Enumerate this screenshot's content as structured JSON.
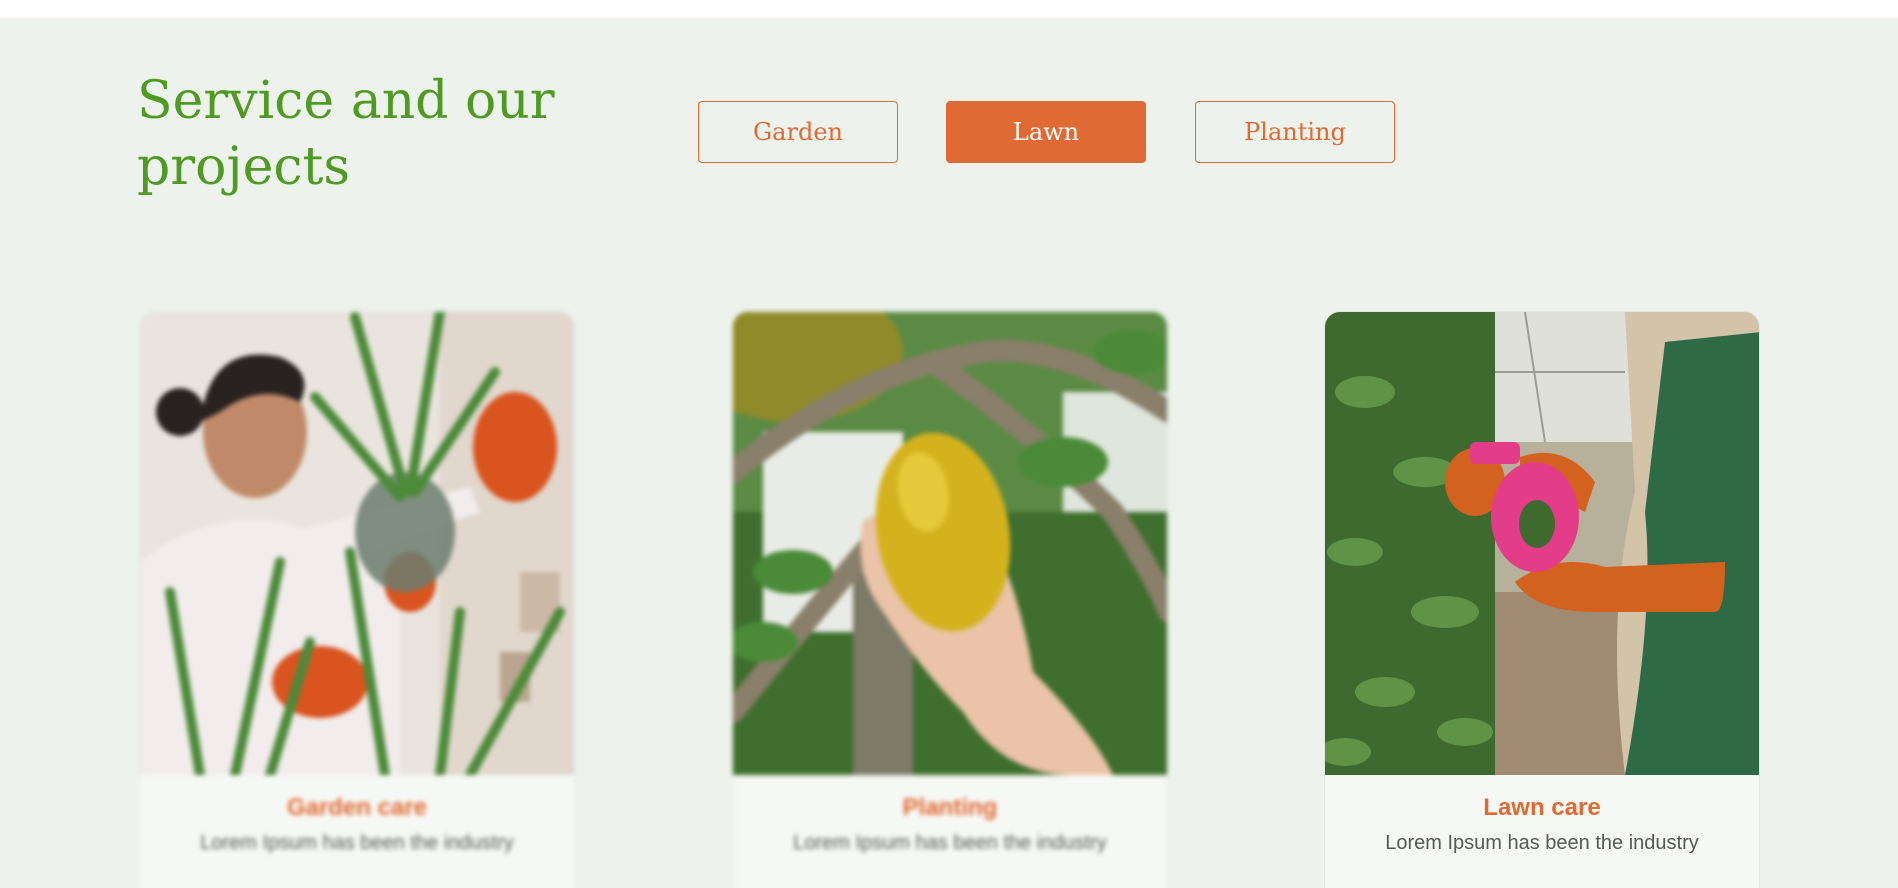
{
  "section": {
    "title": "Service and our projects"
  },
  "tabs": [
    {
      "label": "Garden",
      "active": false
    },
    {
      "label": "Lawn",
      "active": true
    },
    {
      "label": "Planting",
      "active": false
    }
  ],
  "cards": [
    {
      "title": "Garden care",
      "description": "Lorem Ipsum has been the industry",
      "image": "woman-holding-potted-aloe-plant"
    },
    {
      "title": "Planting",
      "description": "Lorem Ipsum has been the industry",
      "image": "hand-picking-lemon-from-tree"
    },
    {
      "title": "Lawn care",
      "description": "Lorem Ipsum has been the industry",
      "image": "gloved-hands-spraying-plants"
    }
  ],
  "colors": {
    "accent": "#e06a34",
    "heading": "#4e9a22",
    "background": "#eef2ec"
  }
}
